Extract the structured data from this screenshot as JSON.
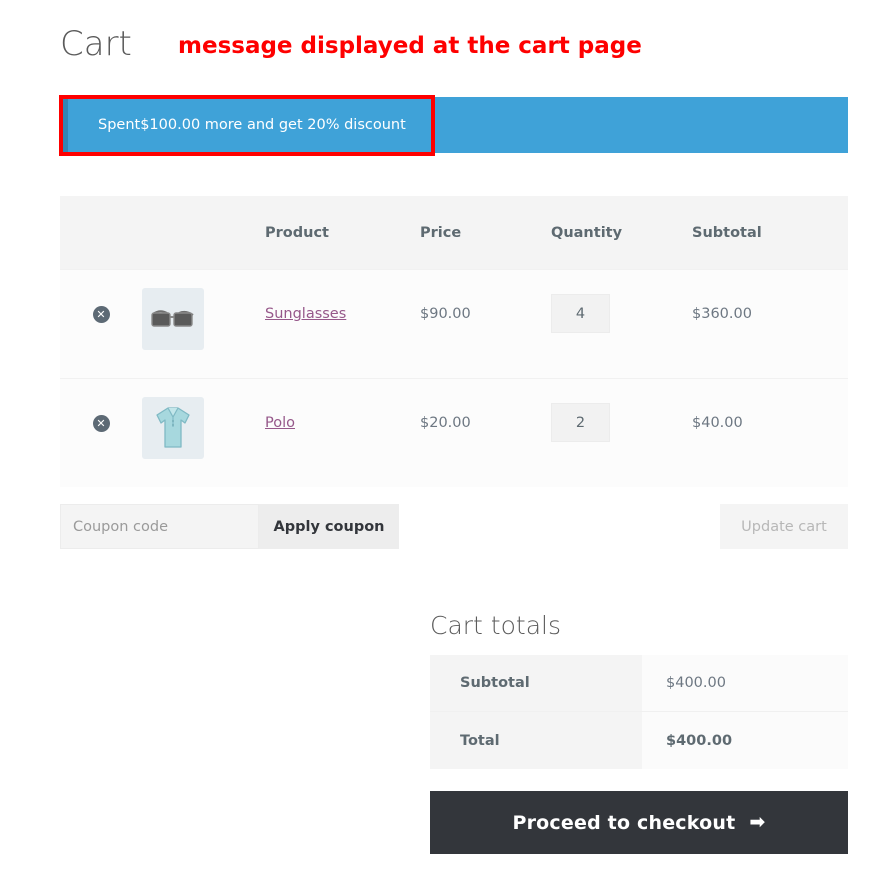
{
  "header": {
    "title": "Cart",
    "annotation": "message displayed at the cart page"
  },
  "notice": {
    "message": "Spent$100.00 more and get 20% discount",
    "background_color": "#3fa2d8",
    "border_color": "#3387b5",
    "annotation_color": "#fe0000"
  },
  "cart_table": {
    "columns": {
      "remove": "",
      "thumbnail": "",
      "product": "Product",
      "price": "Price",
      "quantity": "Quantity",
      "subtotal": "Subtotal"
    },
    "rows": [
      {
        "remove_label": "✕",
        "thumbnail": "sunglasses-thumbnail",
        "product": "Sunglasses",
        "price": "$90.00",
        "quantity": "4",
        "subtotal": "$360.00"
      },
      {
        "remove_label": "✕",
        "thumbnail": "polo-shirt-thumbnail",
        "product": "Polo",
        "price": "$20.00",
        "quantity": "2",
        "subtotal": "$40.00"
      }
    ]
  },
  "actions": {
    "coupon_value": "",
    "coupon_placeholder": "Coupon code",
    "apply_coupon_label": "Apply coupon",
    "update_cart_label": "Update cart"
  },
  "totals": {
    "title": "Cart totals",
    "subtotal_label": "Subtotal",
    "subtotal_value": "$400.00",
    "total_label": "Total",
    "total_value": "$400.00",
    "checkout_label": "Proceed to checkout",
    "checkout_arrow": "➡"
  }
}
